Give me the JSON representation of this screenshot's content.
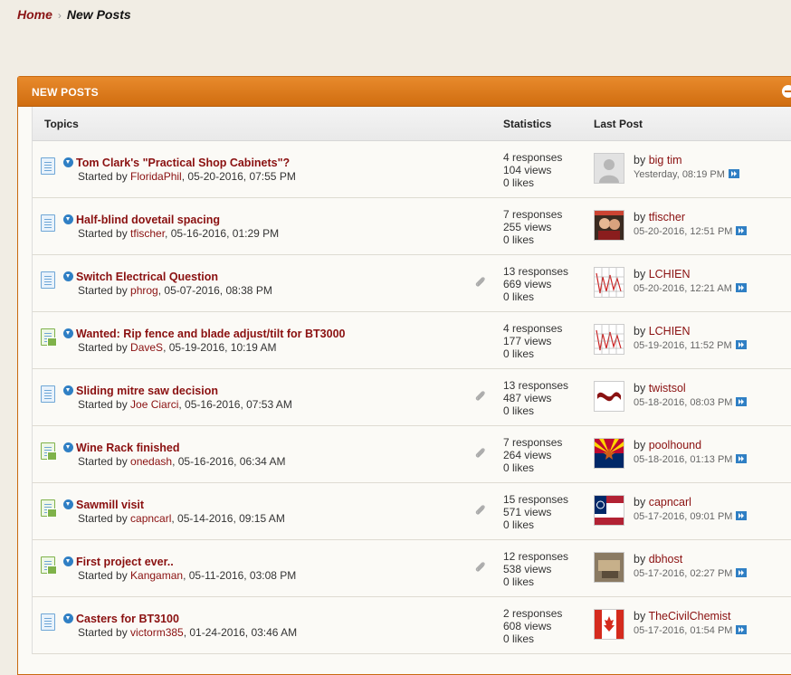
{
  "breadcrumb": {
    "home": "Home",
    "separator": "›",
    "current": "New Posts"
  },
  "panel": {
    "title": "NEW POSTS"
  },
  "columns": {
    "topics": "Topics",
    "statistics": "Statistics",
    "last_post": "Last Post"
  },
  "rows": [
    {
      "title": "Tom Clark's \"Practical Shop Cabinets\"?",
      "started_prefix": "Started by ",
      "author": "FloridaPhil",
      "started_date": ", 05-20-2016, 07:55 PM",
      "responses": "4 responses",
      "views": "104 views",
      "likes": "0 likes",
      "last_by_prefix": "by ",
      "last_user": "big tim",
      "last_date": "Yesterday, 08:19 PM",
      "icon": "doc",
      "attachment": false,
      "avatar": "default"
    },
    {
      "title": "Half-blind dovetail spacing",
      "started_prefix": "Started by ",
      "author": "tfischer",
      "started_date": ", 05-16-2016, 01:29 PM",
      "responses": "7 responses",
      "views": "255 views",
      "likes": "0 likes",
      "last_by_prefix": "by ",
      "last_user": "tfischer",
      "last_date": "05-20-2016, 12:51 PM",
      "icon": "doc",
      "attachment": false,
      "avatar": "people"
    },
    {
      "title": "Switch Electrical Question",
      "started_prefix": "Started by ",
      "author": "phrog",
      "started_date": ", 05-07-2016, 08:38 PM",
      "responses": "13 responses",
      "views": "669 views",
      "likes": "0 likes",
      "last_by_prefix": "by ",
      "last_user": "LCHIEN",
      "last_date": "05-20-2016, 12:21 AM",
      "icon": "doc",
      "attachment": true,
      "avatar": "chart"
    },
    {
      "title": "Wanted: Rip fence and blade adjust/tilt for BT3000",
      "started_prefix": "Started by ",
      "author": "DaveS",
      "started_date": ", 05-19-2016, 10:19 AM",
      "responses": "4 responses",
      "views": "177 views",
      "likes": "0 likes",
      "last_by_prefix": "by ",
      "last_user": "LCHIEN",
      "last_date": "05-19-2016, 11:52 PM",
      "icon": "hot",
      "attachment": false,
      "avatar": "chart"
    },
    {
      "title": "Sliding mitre saw decision",
      "started_prefix": "Started by ",
      "author": "Joe Ciarci",
      "started_date": ", 05-16-2016, 07:53 AM",
      "responses": "13 responses",
      "views": "487 views",
      "likes": "0 likes",
      "last_by_prefix": "by ",
      "last_user": "twistsol",
      "last_date": "05-18-2016, 08:03 PM",
      "icon": "doc",
      "attachment": true,
      "avatar": "twist"
    },
    {
      "title": "Wine Rack finished",
      "started_prefix": "Started by ",
      "author": "onedash",
      "started_date": ", 05-16-2016, 06:34 AM",
      "responses": "7 responses",
      "views": "264 views",
      "likes": "0 likes",
      "last_by_prefix": "by ",
      "last_user": "poolhound",
      "last_date": "05-18-2016, 01:13 PM",
      "icon": "hot",
      "attachment": true,
      "avatar": "arizona"
    },
    {
      "title": "Sawmill visit",
      "started_prefix": "Started by ",
      "author": "capncarl",
      "started_date": ", 05-14-2016, 09:15 AM",
      "responses": "15 responses",
      "views": "571 views",
      "likes": "0 likes",
      "last_by_prefix": "by ",
      "last_user": "capncarl",
      "last_date": "05-17-2016, 09:01 PM",
      "icon": "hot",
      "attachment": true,
      "avatar": "georgia"
    },
    {
      "title": "First project ever..",
      "started_prefix": "Started by ",
      "author": "Kangaman",
      "started_date": ", 05-11-2016, 03:08 PM",
      "responses": "12 responses",
      "views": "538 views",
      "likes": "0 likes",
      "last_by_prefix": "by ",
      "last_user": "dbhost",
      "last_date": "05-17-2016, 02:27 PM",
      "icon": "hot",
      "attachment": true,
      "avatar": "photo"
    },
    {
      "title": "Casters for BT3100",
      "started_prefix": "Started by ",
      "author": "victorm385",
      "started_date": ", 01-24-2016, 03:46 AM",
      "responses": "2 responses",
      "views": "608 views",
      "likes": "0 likes",
      "last_by_prefix": "by ",
      "last_user": "TheCivilChemist",
      "last_date": "05-17-2016, 01:54 PM",
      "icon": "doc",
      "attachment": false,
      "avatar": "canada"
    }
  ]
}
